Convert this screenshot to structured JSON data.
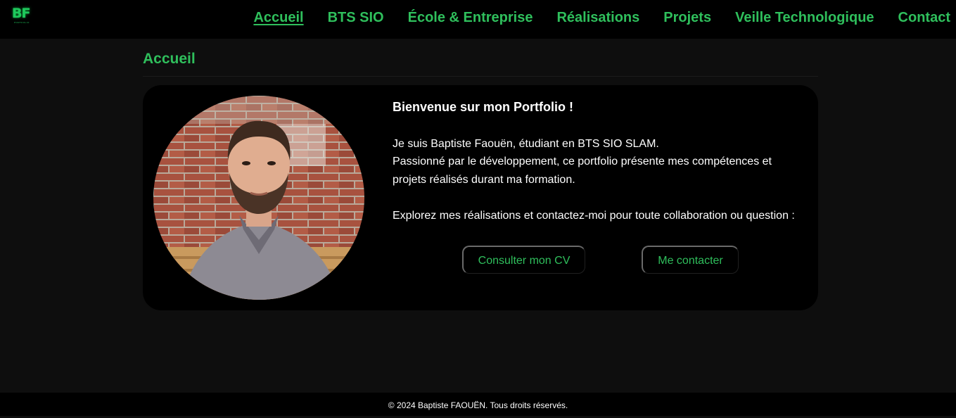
{
  "logo": {
    "letters": "BF",
    "subtitle": "PORTFOLIO",
    "color": "#1ec95c"
  },
  "nav": {
    "items": [
      {
        "label": "Accueil",
        "active": true
      },
      {
        "label": "BTS SIO",
        "active": false
      },
      {
        "label": "École & Entreprise",
        "active": false
      },
      {
        "label": "Réalisations",
        "active": false
      },
      {
        "label": "Projets",
        "active": false
      },
      {
        "label": "Veille Technologique",
        "active": false
      },
      {
        "label": "Contact",
        "active": false
      }
    ]
  },
  "page": {
    "title": "Accueil"
  },
  "intro": {
    "heading": "Bienvenue sur mon Portfolio !",
    "line1": "Je suis Baptiste Faouën, étudiant en BTS SIO SLAM.",
    "line2": "Passionné par le développement, ce portfolio présente mes compétences et projets réalisés durant ma formation.",
    "line3": "Explorez mes réalisations et contactez-moi pour toute collaboration ou question :"
  },
  "buttons": {
    "cv": "Consulter mon CV",
    "contact": "Me contacter"
  },
  "footer": {
    "text": "© 2024 Baptiste FAOUËN. Tous droits réservés."
  },
  "colors": {
    "accent": "#2fbf5c",
    "background": "#0e0e0e",
    "bar": "#000000"
  }
}
